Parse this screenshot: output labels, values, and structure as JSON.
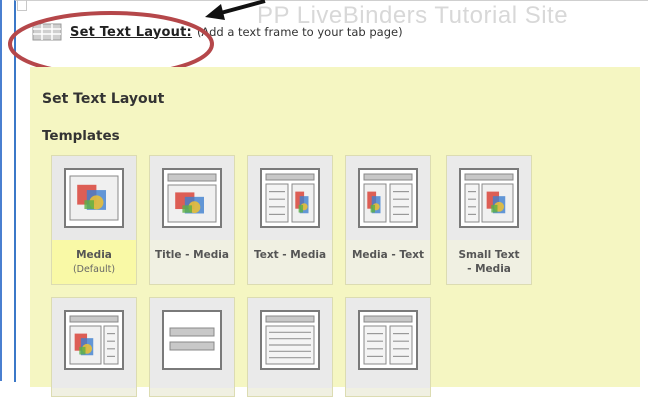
{
  "window": {
    "background_title": "PP LiveBinders Tutorial Site"
  },
  "header": {
    "title": "Set Text Layout:",
    "description": "(Add a text frame to your tab page)"
  },
  "panel": {
    "title": "Set Text Layout",
    "section_label": "Templates",
    "background_color": "#f5f6c2",
    "selected_color": "#f9f9a6"
  },
  "templates": [
    {
      "label": "Media",
      "sublabel": "(Default)",
      "layout": "media",
      "selected": true
    },
    {
      "label": "Title - Media",
      "sublabel": "",
      "layout": "title-media",
      "selected": false
    },
    {
      "label": "Text - Media",
      "sublabel": "",
      "layout": "text-media",
      "selected": false
    },
    {
      "label": "Media - Text",
      "sublabel": "",
      "layout": "media-text",
      "selected": false
    },
    {
      "label": "Small Text - Media",
      "sublabel": "",
      "layout": "small-text-media",
      "selected": false
    },
    {
      "label": "",
      "sublabel": "",
      "layout": "media-small-text",
      "selected": false
    },
    {
      "label": "",
      "sublabel": "",
      "layout": "title-text",
      "selected": false
    },
    {
      "label": "",
      "sublabel": "",
      "layout": "text-full",
      "selected": false
    },
    {
      "label": "",
      "sublabel": "",
      "layout": "two-column-text",
      "selected": false
    }
  ],
  "annotations": {
    "oval_color": "#b5474a",
    "arrow_color": "#111111"
  }
}
